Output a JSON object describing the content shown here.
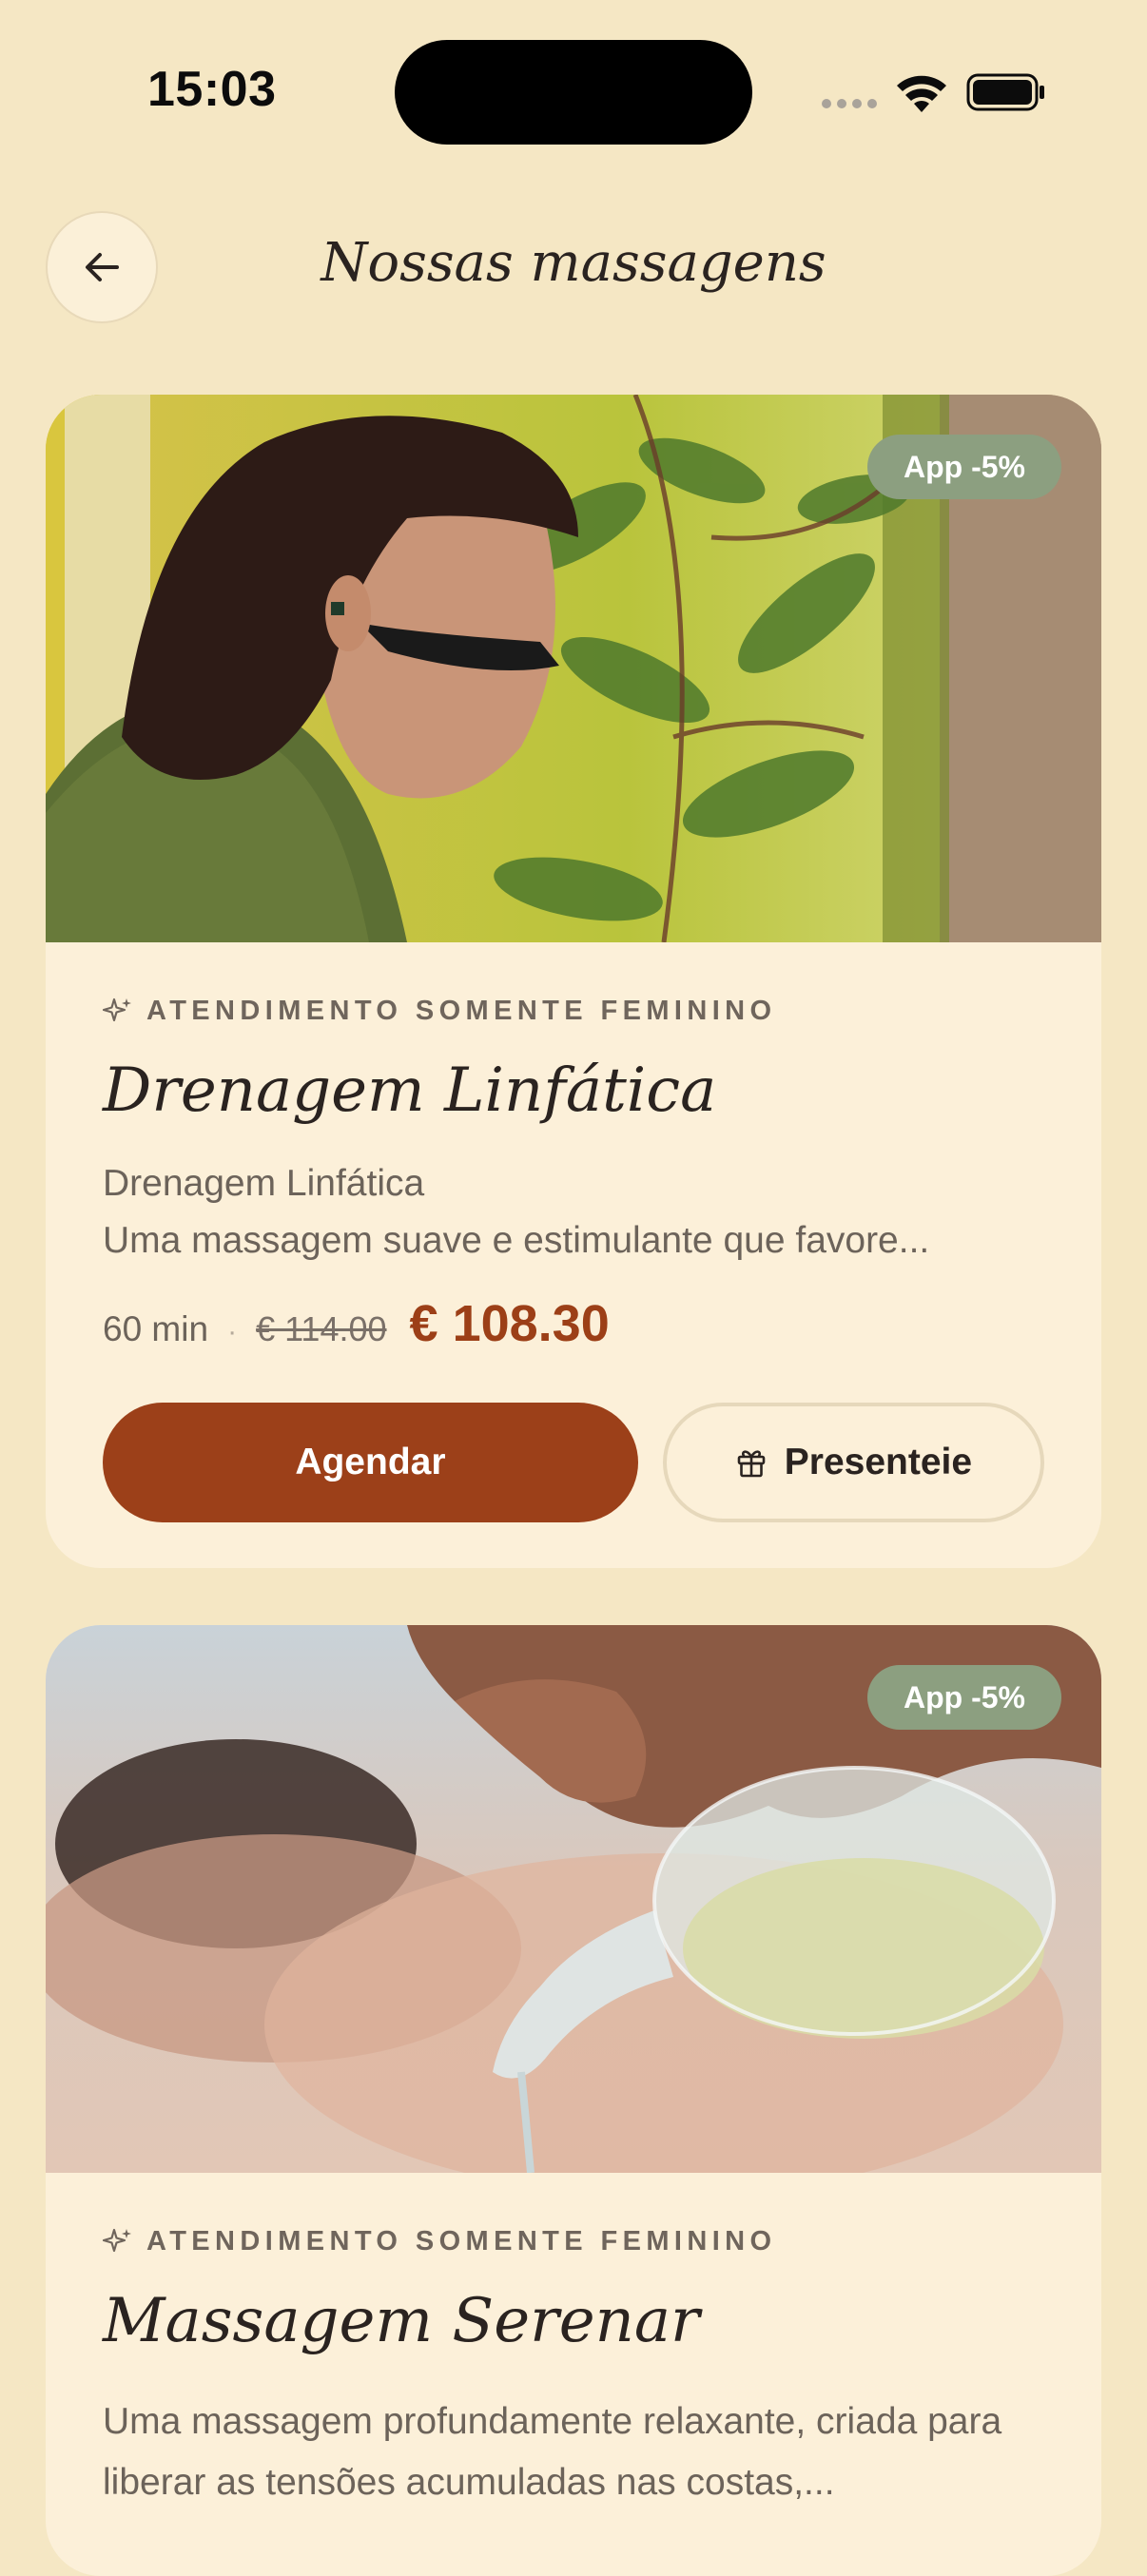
{
  "status_bar": {
    "time": "15:03"
  },
  "header": {
    "title": "Nossas massagens"
  },
  "icons": {
    "back": "arrow-left-icon",
    "sparkle": "sparkle-icon",
    "gift": "gift-icon"
  },
  "colors": {
    "background": "#f5e7c4",
    "card": "#fcf0d9",
    "accent": "#9c4019",
    "badge": "#8c9f80"
  },
  "cards": [
    {
      "badge": "App -5%",
      "tag": "ATENDIMENTO SOMENTE FEMININO",
      "title": "Drenagem Linfática",
      "subtitle": "Drenagem Linfática",
      "description": "Uma massagem suave e estimulante que favore...",
      "duration": "60 min",
      "old_price": "€ 114.00",
      "price": "€ 108.30",
      "book_label": "Agendar",
      "gift_label": "Presenteie"
    },
    {
      "badge": "App -5%",
      "tag": "ATENDIMENTO SOMENTE FEMININO",
      "title": "Massagem Serenar",
      "description": "Uma massagem profundamente relaxante, criada para liberar as tensões acumuladas nas costas,..."
    }
  ]
}
